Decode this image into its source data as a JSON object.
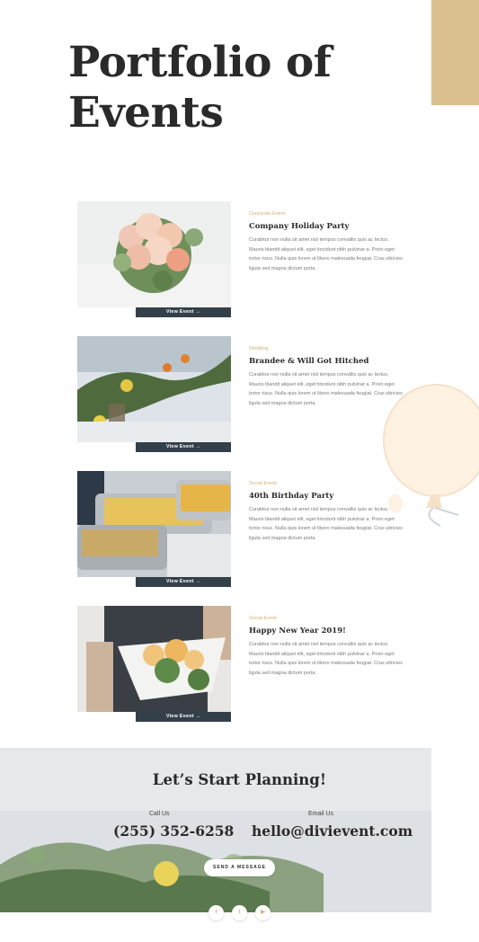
{
  "hero": {
    "title": "Portfolio of Events"
  },
  "colors": {
    "accent_tan": "#d9c08e",
    "button_dark": "#33404a",
    "category_gold": "#d2b07a"
  },
  "events": [
    {
      "category": "Corporate Event",
      "title": "Company Holiday Party",
      "description": "Curabitur non nulla sit amet nisl tempus convallis quis ac lectus. Mauris blandit aliquet elit, eget tincidunt nibh pulvinar a. Proin eget tortor risus. Nulla quis lorem ut libero malesuada feugiat. Cras ultricies ligula sed magna dictum porta.",
      "button": "View Event →",
      "image": "flower-bouquet"
    },
    {
      "category": "Wedding",
      "title": "Brandee & Will Got Hitched",
      "description": "Curabitur non nulla sit amet nisl tempus convallis quis ac lectus. Mauris blandit aliquet elit, eget tincidunt nibh pulvinar a. Proin eget tortor risus. Nulla quis lorem ut libero malesuada feugiat. Cras ultricies ligula sed magna dictum porta.",
      "button": "View Event →",
      "image": "table-garland"
    },
    {
      "category": "Social Event",
      "title": "40th Birthday Party",
      "description": "Curabitur non nulla sit amet nisl tempus convallis quis ac lectus. Mauris blandit aliquet elit, eget tincidunt nibh pulvinar a. Proin eget tortor risus. Nulla quis lorem ut libero malesuada feugiat. Cras ultricies ligula sed magna dictum porta.",
      "button": "View Event →",
      "image": "catering-trays"
    },
    {
      "category": "Social Event",
      "title": "Happy New Year 2019!",
      "description": "Curabitur non nulla sit amet nisl tempus convallis quis ac lectus. Mauris blandit aliquet elit, eget tincidunt nibh pulvinar a. Proin eget tortor risus. Nulla quis lorem ut libero malesuada feugiat. Cras ultricies ligula sed magna dictum porta.",
      "button": "View Event →",
      "image": "food-platter"
    }
  ],
  "cta": {
    "title": "Let’s Start Planning!",
    "call_label": "Call Us",
    "phone": "(255) 352-6258",
    "email_label": "Email Us",
    "email": "hello@divievent.com",
    "send_button": "SEND A MESSAGE"
  },
  "social": [
    {
      "icon": "facebook-icon",
      "glyph": "f"
    },
    {
      "icon": "twitter-icon",
      "glyph": "t"
    },
    {
      "icon": "youtube-icon",
      "glyph": "▶"
    }
  ]
}
